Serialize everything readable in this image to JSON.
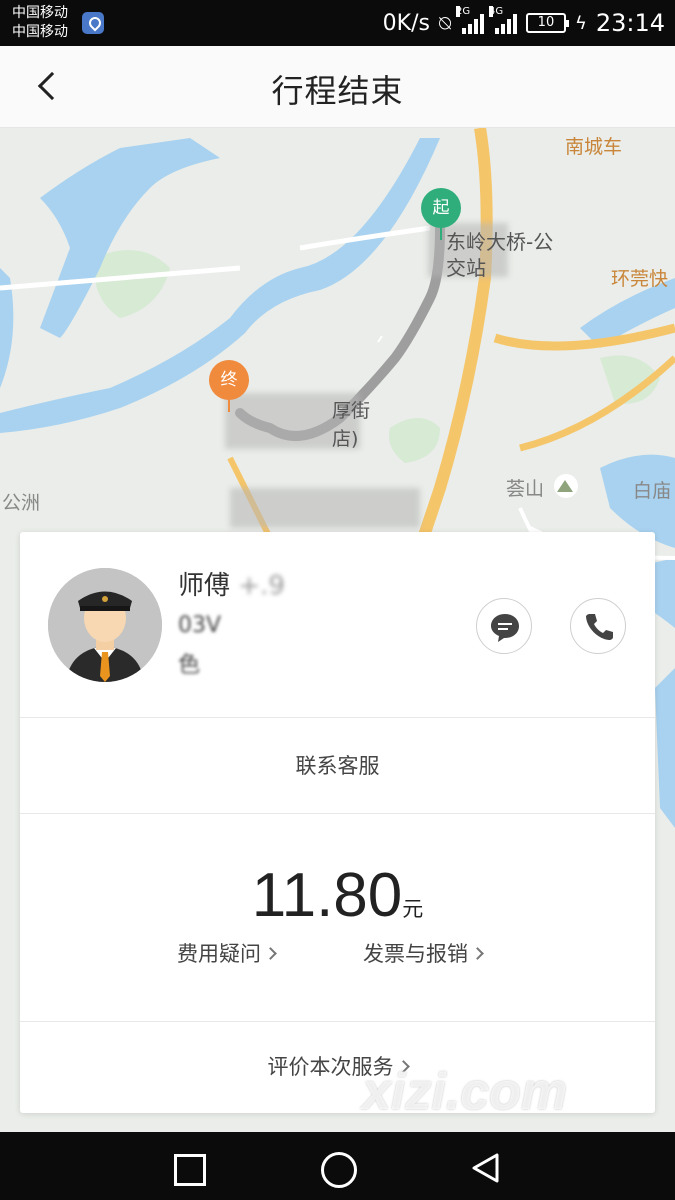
{
  "status_bar": {
    "carrier_1": "中国移动",
    "carrier_2": "中国移动",
    "net_speed": "0K/s",
    "sim1_type": "2G",
    "sim2_type": "4G",
    "battery": "10",
    "time": "23:14"
  },
  "header": {
    "title": "行程结束",
    "back_icon": "back-chevron-icon"
  },
  "map": {
    "labels": {
      "nancheng": "南城车",
      "huanguan": "环莞快",
      "bridge_stop_1": "东岭大桥-公",
      "bridge_stop_2": "交站",
      "end_line_1": "厚街",
      "end_line_2": "店)",
      "gongzhou": "公洲",
      "huishan": "荟山",
      "baimiao": "白庙"
    },
    "start_marker": "起",
    "end_marker": "终",
    "route_color": "#9e9e9e",
    "road_color": "#f5c56a",
    "water_color": "#a8d2f0"
  },
  "driver": {
    "name": "师傅",
    "rating_masked": "+.9",
    "plate": "03V",
    "car_desc": "色"
  },
  "card": {
    "customer_service": "联系客服",
    "fare_amount": "11.80",
    "fare_unit": "元",
    "fare_question": "费用疑问",
    "invoice": "发票与报销",
    "rate_service": "评价本次服务"
  },
  "watermark": "xizi.com",
  "colors": {
    "start_green": "#2fae7b",
    "end_orange": "#f08a3c"
  }
}
